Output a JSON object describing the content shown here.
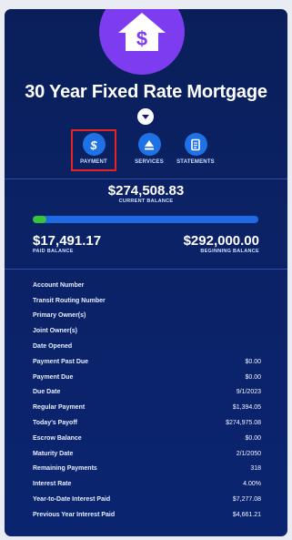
{
  "header": {
    "title": "30 Year Fixed Rate Mortgage"
  },
  "actions": [
    {
      "label": "PAYMENT",
      "icon": "dollar-icon"
    },
    {
      "label": "SERVICES",
      "icon": "eject-icon"
    },
    {
      "label": "STATEMENTS",
      "icon": "document-icon"
    }
  ],
  "balance": {
    "current_value": "$274,508.83",
    "current_label": "CURRENT BALANCE",
    "paid_value": "$17,491.17",
    "paid_label": "PAID BALANCE",
    "beginning_value": "$292,000.00",
    "beginning_label": "BEGINNING BALANCE",
    "progress_fraction": 0.06
  },
  "details": [
    {
      "label": "Account Number",
      "value": ""
    },
    {
      "label": "Transit Routing Number",
      "value": ""
    },
    {
      "label": "Primary Owner(s)",
      "value": ""
    },
    {
      "label": "Joint Owner(s)",
      "value": ""
    },
    {
      "label": "Date Opened",
      "value": ""
    },
    {
      "label": "Payment Past Due",
      "value": "$0.00"
    },
    {
      "label": "Payment Due",
      "value": "$0.00"
    },
    {
      "label": "Due Date",
      "value": "9/1/2023"
    },
    {
      "label": "Regular Payment",
      "value": "$1,394.05"
    },
    {
      "label": "Today's Payoff",
      "value": "$274,975.08"
    },
    {
      "label": "Escrow Balance",
      "value": "$0.00"
    },
    {
      "label": "Maturity Date",
      "value": "2/1/2050"
    },
    {
      "label": "Remaining Payments",
      "value": "318"
    },
    {
      "label": "Interest Rate",
      "value": "4.00%"
    },
    {
      "label": "Year-to-Date Interest Paid",
      "value": "$7,277.08"
    },
    {
      "label": "Previous Year Interest Paid",
      "value": "$4,661.21"
    }
  ],
  "colors": {
    "card_bg": "#0b2266",
    "logo_bg": "#7d3cf0",
    "accent_blue": "#1f72e5",
    "progress_green": "#36c43a",
    "highlight_red": "#e52323"
  }
}
